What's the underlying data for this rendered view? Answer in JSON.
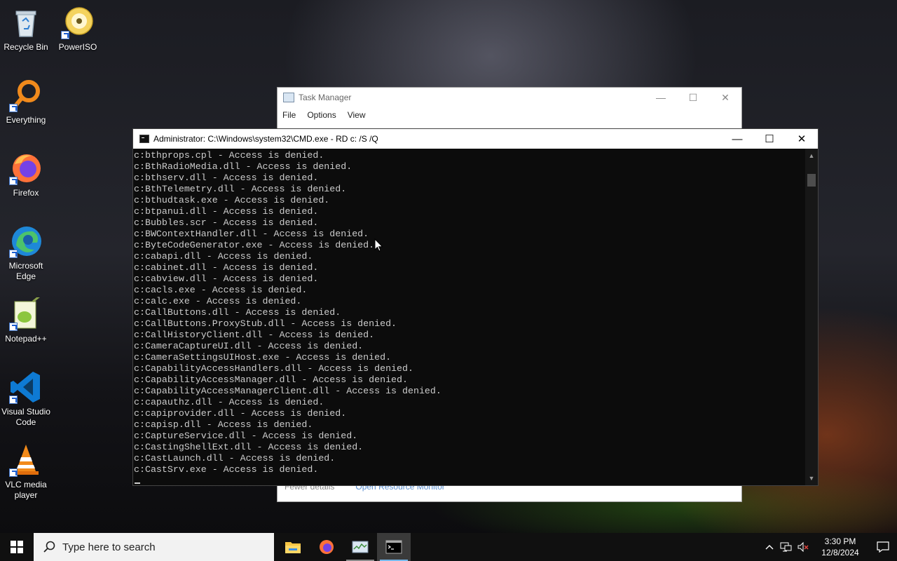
{
  "desktop": {
    "icons": [
      {
        "label": "Recycle Bin",
        "icon": "recycle-bin-icon"
      },
      {
        "label": "PowerISO",
        "icon": "poweriso-icon"
      },
      {
        "label": "Everything",
        "icon": "everything-icon"
      },
      {
        "label": "Firefox",
        "icon": "firefox-icon"
      },
      {
        "label": "Microsoft Edge",
        "icon": "edge-icon"
      },
      {
        "label": "Notepad++",
        "icon": "notepadpp-icon"
      },
      {
        "label": "Visual Studio Code",
        "icon": "vscode-icon"
      },
      {
        "label": "VLC media player",
        "icon": "vlc-icon"
      }
    ]
  },
  "task_manager": {
    "title": "Task Manager",
    "menu": [
      "File",
      "Options",
      "View"
    ],
    "footer_left": "Fewer details",
    "footer_right": "Open Resource Monitor"
  },
  "cmd": {
    "title": "Administrator: C:\\Windows\\system32\\CMD.exe - RD  c: /S /Q",
    "lines": [
      "c:bthprops.cpl - Access is denied.",
      "c:BthRadioMedia.dll - Access is denied.",
      "c:bthserv.dll - Access is denied.",
      "c:BthTelemetry.dll - Access is denied.",
      "c:bthudtask.exe - Access is denied.",
      "c:btpanui.dll - Access is denied.",
      "c:Bubbles.scr - Access is denied.",
      "c:BWContextHandler.dll - Access is denied.",
      "c:ByteCodeGenerator.exe - Access is denied.",
      "c:cabapi.dll - Access is denied.",
      "c:cabinet.dll - Access is denied.",
      "c:cabview.dll - Access is denied.",
      "c:cacls.exe - Access is denied.",
      "c:calc.exe - Access is denied.",
      "c:CallButtons.dll - Access is denied.",
      "c:CallButtons.ProxyStub.dll - Access is denied.",
      "c:CallHistoryClient.dll - Access is denied.",
      "c:CameraCaptureUI.dll - Access is denied.",
      "c:CameraSettingsUIHost.exe - Access is denied.",
      "c:CapabilityAccessHandlers.dll - Access is denied.",
      "c:CapabilityAccessManager.dll - Access is denied.",
      "c:CapabilityAccessManagerClient.dll - Access is denied.",
      "c:capauthz.dll - Access is denied.",
      "c:capiprovider.dll - Access is denied.",
      "c:capisp.dll - Access is denied.",
      "c:CaptureService.dll - Access is denied.",
      "c:CastingShellExt.dll - Access is denied.",
      "c:CastLaunch.dll - Access is denied.",
      "c:CastSrv.exe - Access is denied."
    ]
  },
  "taskbar": {
    "search_placeholder": "Type here to search",
    "apps": [
      "file-explorer-icon",
      "firefox-icon",
      "task-manager-icon",
      "cmd-icon"
    ],
    "active_app": "cmd-icon",
    "time": "3:30 PM",
    "date": "12/8/2024"
  },
  "colors": {
    "terminal_bg": "#0c0c0c",
    "terminal_fg": "#cccccc",
    "taskbar_bg": "#101010",
    "accent": "#76b9ed"
  }
}
